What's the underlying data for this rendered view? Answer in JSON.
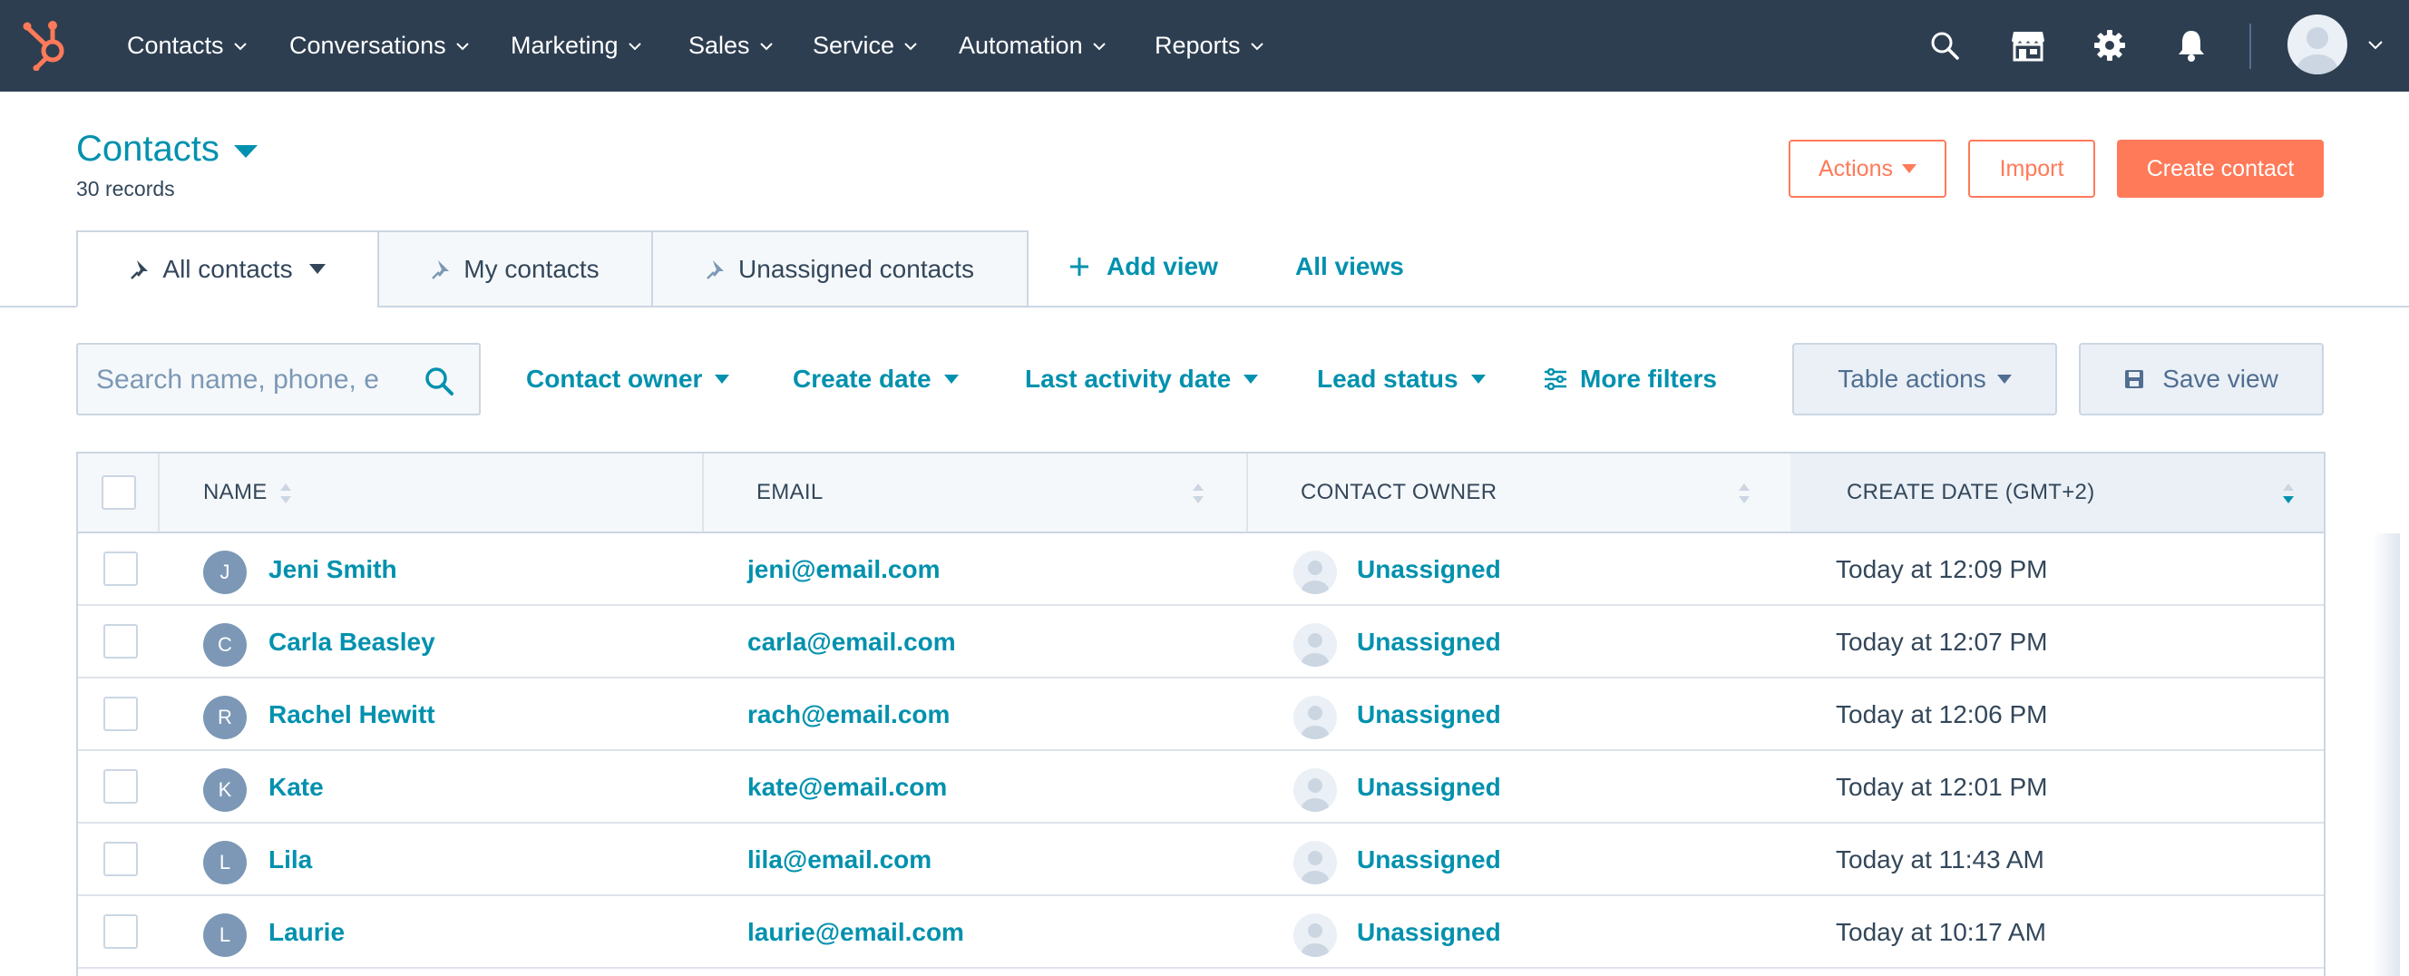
{
  "nav": {
    "items": [
      {
        "label": "Contacts"
      },
      {
        "label": "Conversations"
      },
      {
        "label": "Marketing"
      },
      {
        "label": "Sales"
      },
      {
        "label": "Service"
      },
      {
        "label": "Automation"
      },
      {
        "label": "Reports"
      }
    ],
    "icons": [
      "search-icon",
      "marketplace-icon",
      "gear-icon",
      "bell-icon"
    ]
  },
  "header": {
    "title": "Contacts",
    "records": "30 records",
    "actions_label": "Actions",
    "import_label": "Import",
    "create_label": "Create contact"
  },
  "tabs": {
    "items": [
      {
        "label": "All contacts"
      },
      {
        "label": "My contacts"
      },
      {
        "label": "Unassigned contacts"
      }
    ],
    "add_view": "Add view",
    "all_views": "All views"
  },
  "filters": {
    "search_placeholder": "Search name, phone, e",
    "contact_owner": "Contact owner",
    "create_date": "Create date",
    "last_activity": "Last activity date",
    "lead_status": "Lead status",
    "more_filters": "More filters",
    "table_actions": "Table actions",
    "save_view": "Save view"
  },
  "table": {
    "columns": [
      "NAME",
      "EMAIL",
      "CONTACT OWNER",
      "CREATE DATE (GMT+2)"
    ],
    "rows": [
      {
        "initial": "J",
        "name": "Jeni Smith",
        "email": "jeni@email.com",
        "owner": "Unassigned",
        "date": "Today at 12:09 PM"
      },
      {
        "initial": "C",
        "name": "Carla Beasley",
        "email": "carla@email.com",
        "owner": "Unassigned",
        "date": "Today at 12:07 PM"
      },
      {
        "initial": "R",
        "name": "Rachel Hewitt",
        "email": "rach@email.com",
        "owner": "Unassigned",
        "date": "Today at 12:06 PM"
      },
      {
        "initial": "K",
        "name": "Kate",
        "email": "kate@email.com",
        "owner": "Unassigned",
        "date": "Today at 12:01 PM"
      },
      {
        "initial": "L",
        "name": "Lila",
        "email": "lila@email.com",
        "owner": "Unassigned",
        "date": "Today at 11:43 AM"
      },
      {
        "initial": "L",
        "name": "Laurie",
        "email": "laurie@email.com",
        "owner": "Unassigned",
        "date": "Today at 10:17 AM"
      }
    ]
  },
  "colors": {
    "nav_bg": "#2d3e50",
    "link": "#0091ae",
    "accent": "#ff7a59",
    "text": "#33475b",
    "border": "#cbd6e2"
  }
}
